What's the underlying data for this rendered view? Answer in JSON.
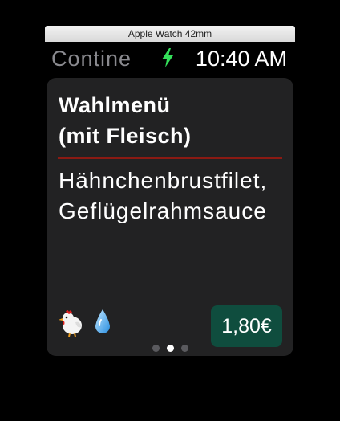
{
  "simulator": {
    "title": "Apple Watch 42mm"
  },
  "status_bar": {
    "app_name": "Contine",
    "charging_icon": "lightning-bolt",
    "time": "10:40 AM",
    "charge_color": "#34e05a"
  },
  "menu_card": {
    "title_line1": "Wahlmenü",
    "title_line2": "(mit Fleisch)",
    "dish": "Hähnchenbrustfilet, Geflügelrahmsauce",
    "icons": [
      "chicken-icon",
      "water-drop-icon"
    ],
    "price": "1,80€",
    "accent_color": "#8b1a13",
    "price_bg_color": "#0f4d3e"
  },
  "pager": {
    "page_count": 3,
    "current_page": 2
  }
}
